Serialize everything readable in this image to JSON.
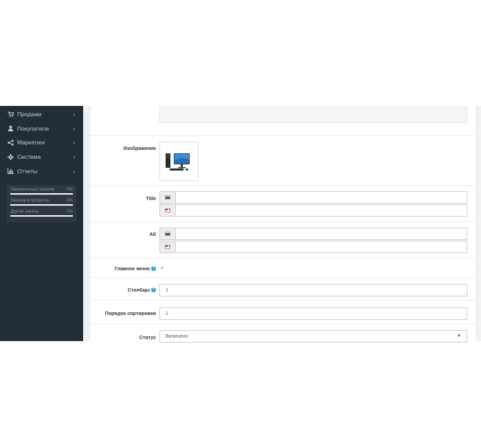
{
  "sidebar": {
    "items": [
      {
        "label": "Продажи",
        "icon": "cart-icon"
      },
      {
        "label": "Покупатели",
        "icon": "user-icon"
      },
      {
        "label": "Маркетинг",
        "icon": "share-icon"
      },
      {
        "label": "Система",
        "icon": "gear-icon"
      },
      {
        "label": "Отчеты",
        "icon": "bar-chart-icon"
      }
    ],
    "stats": [
      {
        "label": "Завершенных заказов",
        "value": "0%"
      },
      {
        "label": "Заказов в процессе",
        "value": "0%"
      },
      {
        "label": "Другие заказы",
        "value": "0%"
      }
    ]
  },
  "form": {
    "image_label": "Изображение",
    "title_label": "Title",
    "title_values": [
      "",
      ""
    ],
    "alt_label": "Alt",
    "alt_values": [
      "",
      ""
    ],
    "main_menu_label": "Главное меню",
    "main_menu_checked": true,
    "columns_label": "Столбцы",
    "columns_value": "1",
    "sort_label": "Порядок сортировки",
    "sort_value": "1",
    "status_label": "Статус",
    "status_value": "Включено"
  },
  "colors": {
    "sidebar_bg": "#232d38",
    "help_icon": "#2a9fd6"
  }
}
